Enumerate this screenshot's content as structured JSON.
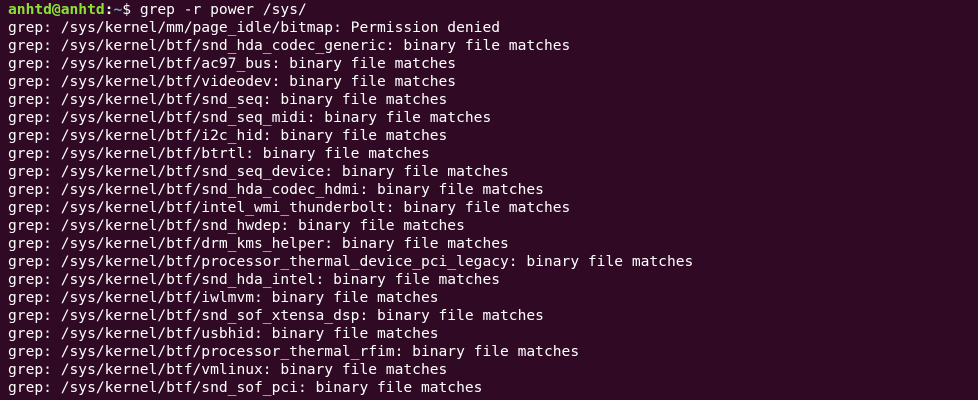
{
  "prompt": {
    "user_host": "anhtd@anhtd",
    "separator": ":",
    "path": "~",
    "symbol": "$ ",
    "command": "grep -r power /sys/"
  },
  "output": [
    "grep: /sys/kernel/mm/page_idle/bitmap: Permission denied",
    "grep: /sys/kernel/btf/snd_hda_codec_generic: binary file matches",
    "grep: /sys/kernel/btf/ac97_bus: binary file matches",
    "grep: /sys/kernel/btf/videodev: binary file matches",
    "grep: /sys/kernel/btf/snd_seq: binary file matches",
    "grep: /sys/kernel/btf/snd_seq_midi: binary file matches",
    "grep: /sys/kernel/btf/i2c_hid: binary file matches",
    "grep: /sys/kernel/btf/btrtl: binary file matches",
    "grep: /sys/kernel/btf/snd_seq_device: binary file matches",
    "grep: /sys/kernel/btf/snd_hda_codec_hdmi: binary file matches",
    "grep: /sys/kernel/btf/intel_wmi_thunderbolt: binary file matches",
    "grep: /sys/kernel/btf/snd_hwdep: binary file matches",
    "grep: /sys/kernel/btf/drm_kms_helper: binary file matches",
    "grep: /sys/kernel/btf/processor_thermal_device_pci_legacy: binary file matches",
    "grep: /sys/kernel/btf/snd_hda_intel: binary file matches",
    "grep: /sys/kernel/btf/iwlmvm: binary file matches",
    "grep: /sys/kernel/btf/snd_sof_xtensa_dsp: binary file matches",
    "grep: /sys/kernel/btf/usbhid: binary file matches",
    "grep: /sys/kernel/btf/processor_thermal_rfim: binary file matches",
    "grep: /sys/kernel/btf/vmlinux: binary file matches",
    "grep: /sys/kernel/btf/snd_sof_pci: binary file matches"
  ],
  "colors": {
    "background": "#300a24",
    "text": "#ffffff",
    "user_host": "#8ae234",
    "path": "#729fcf"
  }
}
